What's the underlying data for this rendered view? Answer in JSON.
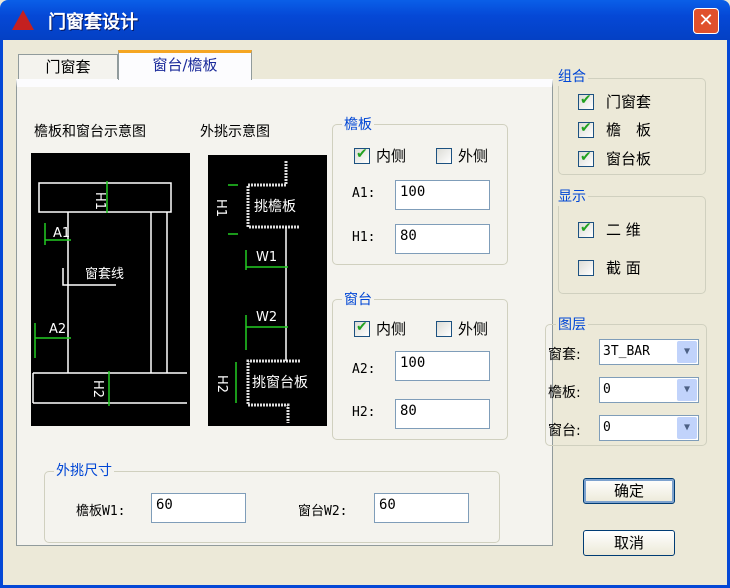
{
  "window": {
    "title": "门窗套设计",
    "close": "✕"
  },
  "tabs": [
    {
      "label": "门窗套"
    },
    {
      "label": "窗台/檐板"
    }
  ],
  "captions": {
    "left": "檐板和窗台示意图",
    "right": "外挑示意图"
  },
  "diagram_left": {
    "h1": "H1",
    "a1": "A1",
    "line": "窗套线",
    "a2": "A2",
    "h2": "H2"
  },
  "diagram_right": {
    "h1": "H1",
    "eave": "挑檐板",
    "w1": "W1",
    "w2": "W2",
    "h2": "H2",
    "sill": "挑窗台板"
  },
  "eave": {
    "title": "檐板",
    "inner": "内侧",
    "inner_checked": true,
    "outer": "外侧",
    "outer_checked": false,
    "a1_label": "A1:",
    "a1": "100",
    "h1_label": "H1:",
    "h1": "80"
  },
  "sill": {
    "title": "窗台",
    "inner": "内侧",
    "inner_checked": true,
    "outer": "外侧",
    "outer_checked": false,
    "a2_label": "A2:",
    "a2": "100",
    "h2_label": "H2:",
    "h2": "80"
  },
  "overhang": {
    "title": "外挑尺寸",
    "w1_label": "檐板W1:",
    "w1": "60",
    "w2_label": "窗台W2:",
    "w2": "60"
  },
  "combo": {
    "title": "组合",
    "items": [
      {
        "label": "门窗套",
        "checked": true
      },
      {
        "label": "檐　板",
        "checked": true
      },
      {
        "label": "窗台板",
        "checked": true
      }
    ]
  },
  "display": {
    "title": "显示",
    "items": [
      {
        "label": "二 维",
        "checked": true
      },
      {
        "label": "截 面",
        "checked": false
      }
    ]
  },
  "layers": {
    "title": "图层",
    "rows": [
      {
        "label": "窗套:",
        "value": "3T_BAR"
      },
      {
        "label": "檐板:",
        "value": "0"
      },
      {
        "label": "窗台:",
        "value": "0"
      }
    ]
  },
  "buttons": {
    "ok": "确定",
    "cancel": "取消"
  }
}
